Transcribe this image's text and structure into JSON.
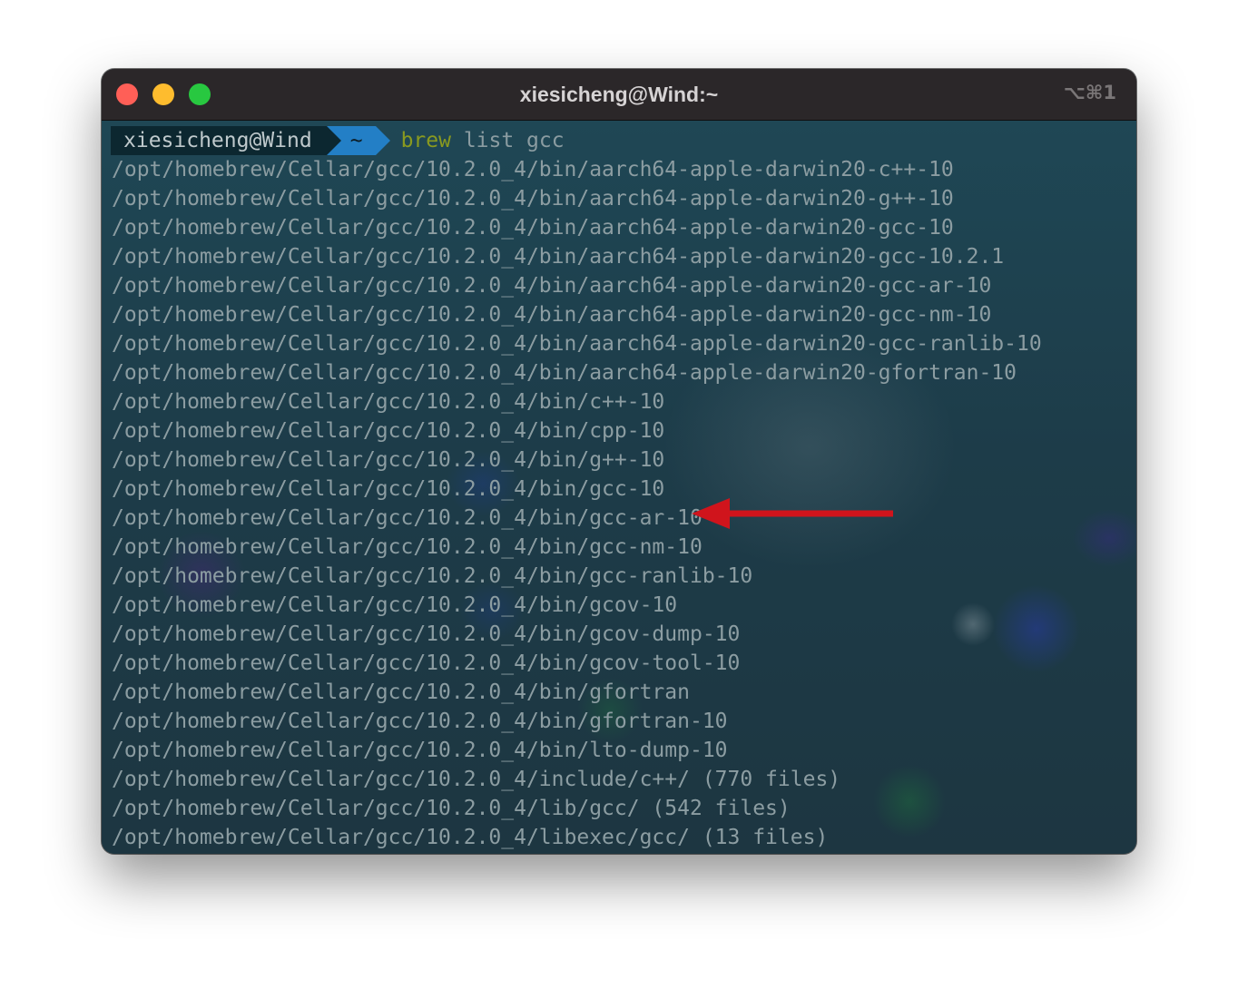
{
  "window": {
    "title": "xiesicheng@Wind:~",
    "shortcut": "⌥⌘1"
  },
  "prompt": {
    "user_host": "xiesicheng@Wind",
    "cwd": "~",
    "command": "brew",
    "args": " list gcc"
  },
  "output_lines": [
    "/opt/homebrew/Cellar/gcc/10.2.0_4/bin/aarch64-apple-darwin20-c++-10",
    "/opt/homebrew/Cellar/gcc/10.2.0_4/bin/aarch64-apple-darwin20-g++-10",
    "/opt/homebrew/Cellar/gcc/10.2.0_4/bin/aarch64-apple-darwin20-gcc-10",
    "/opt/homebrew/Cellar/gcc/10.2.0_4/bin/aarch64-apple-darwin20-gcc-10.2.1",
    "/opt/homebrew/Cellar/gcc/10.2.0_4/bin/aarch64-apple-darwin20-gcc-ar-10",
    "/opt/homebrew/Cellar/gcc/10.2.0_4/bin/aarch64-apple-darwin20-gcc-nm-10",
    "/opt/homebrew/Cellar/gcc/10.2.0_4/bin/aarch64-apple-darwin20-gcc-ranlib-10",
    "/opt/homebrew/Cellar/gcc/10.2.0_4/bin/aarch64-apple-darwin20-gfortran-10",
    "/opt/homebrew/Cellar/gcc/10.2.0_4/bin/c++-10",
    "/opt/homebrew/Cellar/gcc/10.2.0_4/bin/cpp-10",
    "/opt/homebrew/Cellar/gcc/10.2.0_4/bin/g++-10",
    "/opt/homebrew/Cellar/gcc/10.2.0_4/bin/gcc-10",
    "/opt/homebrew/Cellar/gcc/10.2.0_4/bin/gcc-ar-10",
    "/opt/homebrew/Cellar/gcc/10.2.0_4/bin/gcc-nm-10",
    "/opt/homebrew/Cellar/gcc/10.2.0_4/bin/gcc-ranlib-10",
    "/opt/homebrew/Cellar/gcc/10.2.0_4/bin/gcov-10",
    "/opt/homebrew/Cellar/gcc/10.2.0_4/bin/gcov-dump-10",
    "/opt/homebrew/Cellar/gcc/10.2.0_4/bin/gcov-tool-10",
    "/opt/homebrew/Cellar/gcc/10.2.0_4/bin/gfortran",
    "/opt/homebrew/Cellar/gcc/10.2.0_4/bin/gfortran-10",
    "/opt/homebrew/Cellar/gcc/10.2.0_4/bin/lto-dump-10",
    "/opt/homebrew/Cellar/gcc/10.2.0_4/include/c++/ (770 files)",
    "/opt/homebrew/Cellar/gcc/10.2.0_4/lib/gcc/ (542 files)",
    "/opt/homebrew/Cellar/gcc/10.2.0_4/libexec/gcc/ (13 files)"
  ],
  "annotation": {
    "icon": "red-arrow-left-icon",
    "color": "#d0141c"
  },
  "colors": {
    "traffic_close": "#ff5f57",
    "traffic_minimize": "#febc2e",
    "traffic_maximize": "#28c840",
    "prompt_cwd_segment": "#237fc6",
    "command_color": "#8a9a1f"
  }
}
